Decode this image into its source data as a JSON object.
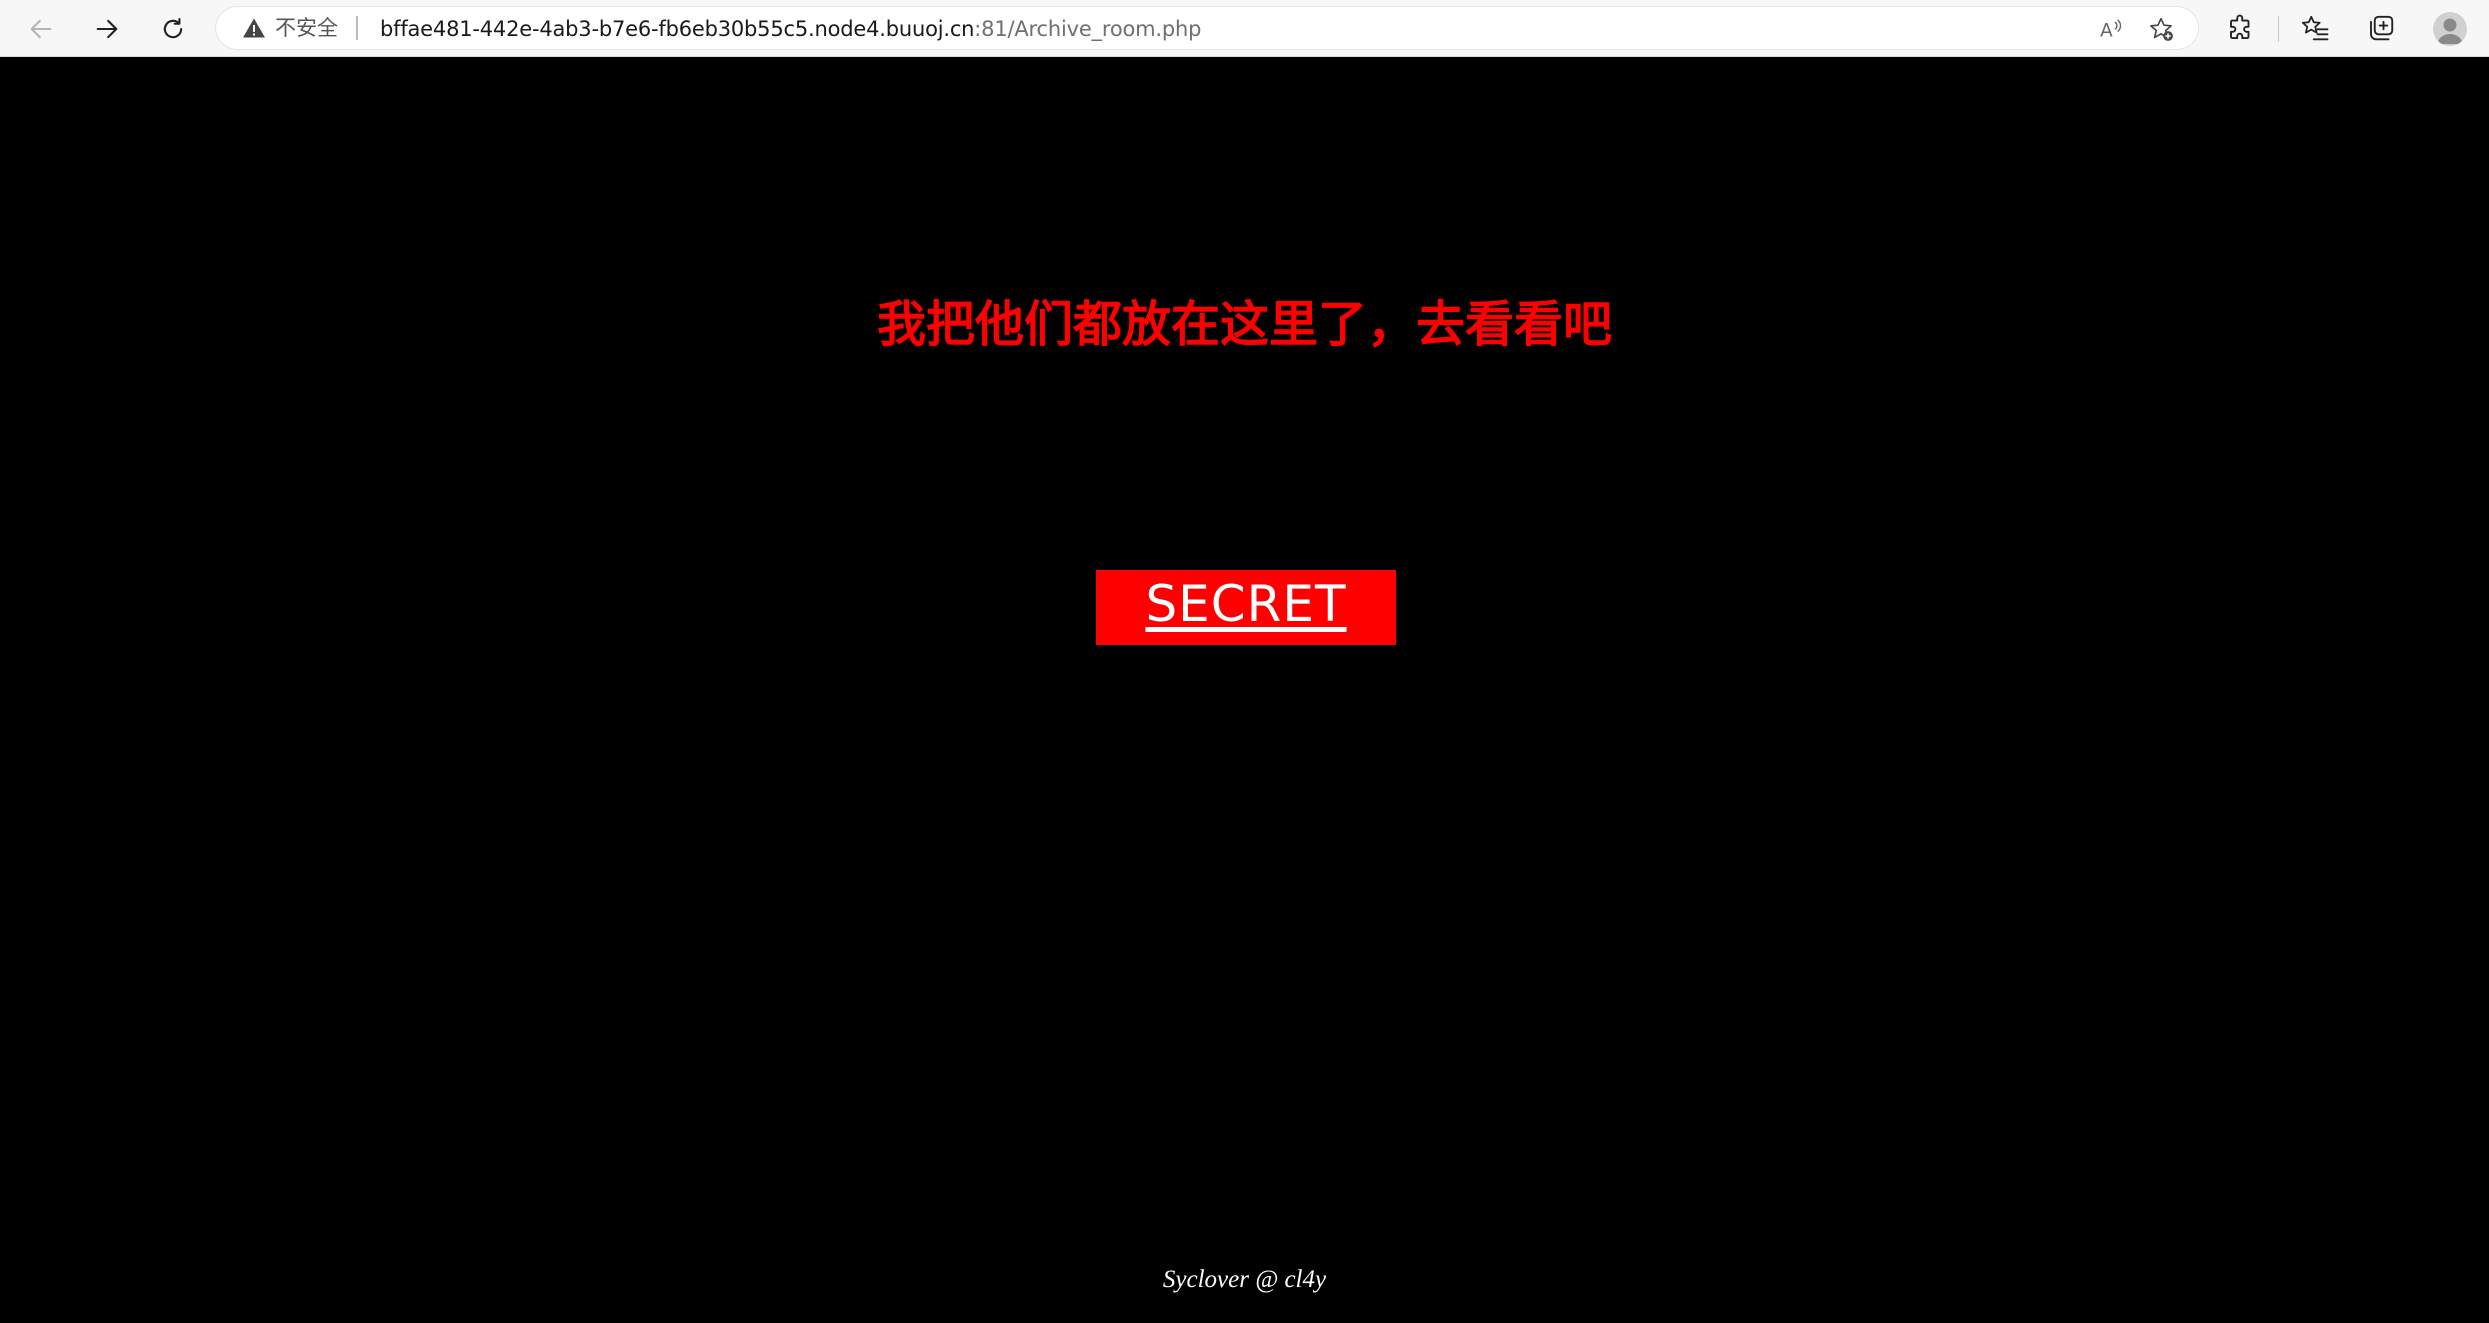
{
  "browser": {
    "security_label": "不安全",
    "url_host": "bffae481-442e-4ab3-b7e6-fb6eb30b55c5.node4.buuoj.cn",
    "url_rest": ":81/Archive_room.php",
    "icons": [
      "back-arrow-icon",
      "forward-arrow-icon",
      "refresh-icon",
      "warning-icon",
      "read-aloud-icon",
      "add-favorite-icon",
      "extensions-icon",
      "favorites-icon",
      "collections-icon",
      "profile-avatar-icon"
    ]
  },
  "page": {
    "heading": "我把他们都放在这里了，去看看吧",
    "secret_link": "SECRET",
    "footer": "Syclover @ cl4y",
    "colors": {
      "background": "#000000",
      "accent": "#ff0000",
      "text": "#ffffff"
    }
  }
}
